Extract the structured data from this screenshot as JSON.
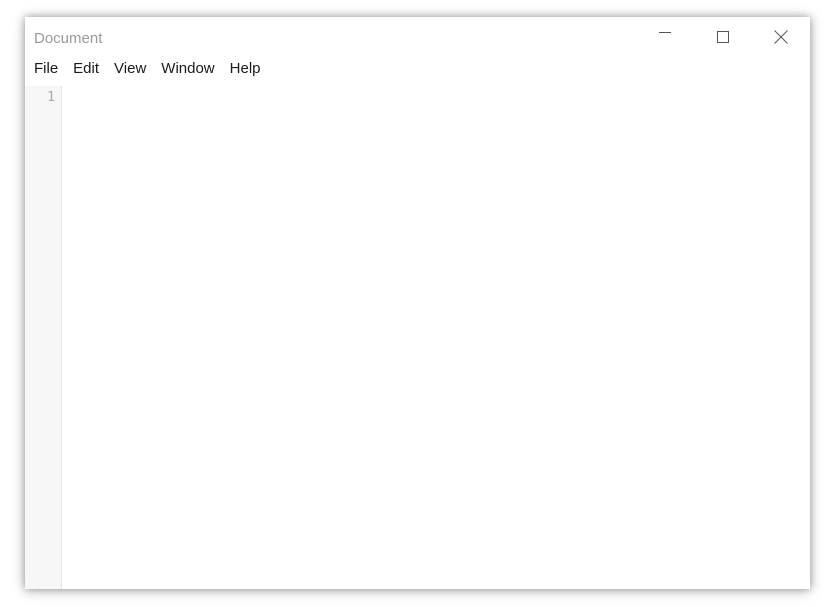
{
  "window": {
    "title": "Document"
  },
  "controls": {
    "minimize_icon": "minimize-icon",
    "maximize_icon": "maximize-icon",
    "close_icon": "close-icon"
  },
  "menu": {
    "items": [
      {
        "label": "File"
      },
      {
        "label": "Edit"
      },
      {
        "label": "View"
      },
      {
        "label": "Window"
      },
      {
        "label": "Help"
      }
    ]
  },
  "editor": {
    "line_numbers": [
      "1"
    ],
    "content": ""
  },
  "colors": {
    "title_text": "#9a9a9a",
    "menu_text": "#1a1a1a",
    "gutter_bg": "#f7f7f7",
    "line_number_text": "#a8a8a8"
  }
}
